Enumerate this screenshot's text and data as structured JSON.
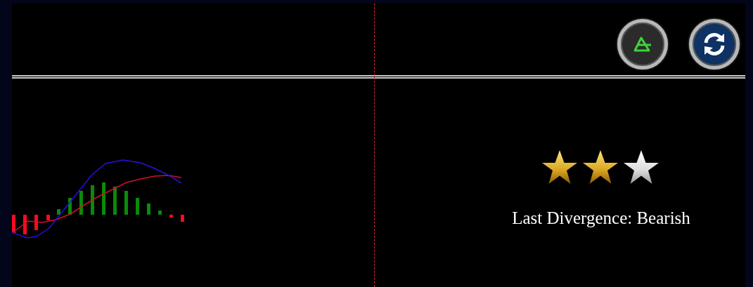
{
  "toolbar": {
    "buttons": [
      {
        "kind": "triangle"
      },
      {
        "kind": "refresh"
      }
    ]
  },
  "rating": {
    "stars": 2
  },
  "status": {
    "text": "Last Divergence: Bearish"
  }
}
